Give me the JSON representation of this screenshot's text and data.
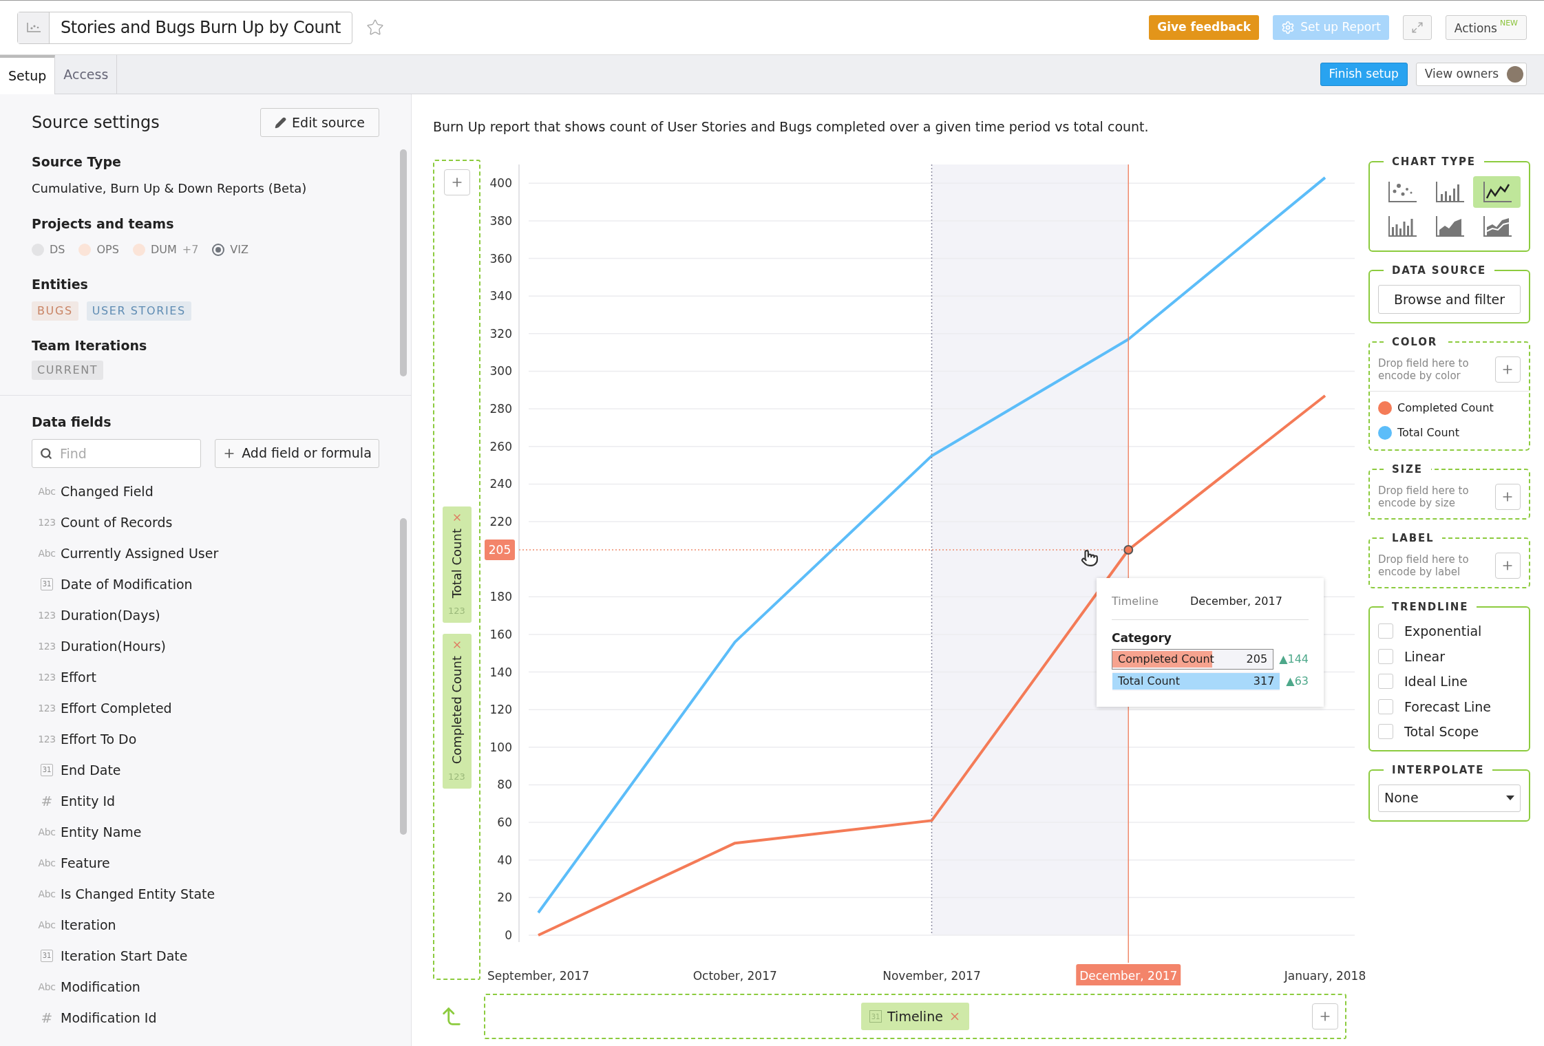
{
  "header": {
    "title": "Stories and Bugs Burn Up by Count",
    "starred": false,
    "feedback_button": "Give feedback",
    "setup_button": "Set up Report",
    "actions_button": "Actions",
    "actions_badge": "NEW"
  },
  "tabs": [
    {
      "label": "Setup",
      "selected": true
    },
    {
      "label": "Access",
      "selected": false
    }
  ],
  "toolbar": {
    "finish_button": "Finish setup",
    "owners_button": "View owners"
  },
  "source_settings": {
    "title": "Source settings",
    "edit_button": "Edit source",
    "source_type_label": "Source Type",
    "source_type": "Cumulative, Burn Up & Down Reports (Beta)",
    "projects_label": "Projects and teams",
    "projects": [
      {
        "kind": "dot",
        "name": "DS",
        "color": "#e3e3e5"
      },
      {
        "kind": "dot",
        "name": "OPS",
        "color": "#fbe4d8"
      },
      {
        "kind": "dot",
        "name": "DUM",
        "color": "#fbe4d8",
        "more": "+7"
      },
      {
        "kind": "emblem",
        "name": "VIZ",
        "color": "#70757d"
      }
    ],
    "entities_label": "Entities",
    "entities": [
      {
        "name": "BUGS",
        "color": "#c98465"
      },
      {
        "name": "USER STORIES",
        "color": "#5f8cb3"
      }
    ],
    "iterations_label": "Team Iterations",
    "iterations": [
      "CURRENT"
    ]
  },
  "data_fields": {
    "title": "Data fields",
    "search": {
      "placeholder": "Find"
    },
    "add_button": "Add field or formula",
    "items": [
      {
        "kind": "text",
        "type_label": "Abc",
        "name": "Changed Field"
      },
      {
        "kind": "number",
        "type_label": "123",
        "name": "Count of Records"
      },
      {
        "kind": "text",
        "type_label": "Abc",
        "name": "Currently Assigned User"
      },
      {
        "kind": "date",
        "type_label": "31",
        "name": "Date of Modification"
      },
      {
        "kind": "number",
        "type_label": "123",
        "name": "Duration(Days)"
      },
      {
        "kind": "number",
        "type_label": "123",
        "name": "Duration(Hours)"
      },
      {
        "kind": "number",
        "type_label": "123",
        "name": "Effort"
      },
      {
        "kind": "number",
        "type_label": "123",
        "name": "Effort Completed"
      },
      {
        "kind": "number",
        "type_label": "123",
        "name": "Effort To Do"
      },
      {
        "kind": "date",
        "type_label": "31",
        "name": "End Date"
      },
      {
        "kind": "id",
        "type_label": "#",
        "name": "Entity Id"
      },
      {
        "kind": "text",
        "type_label": "Abc",
        "name": "Entity Name"
      },
      {
        "kind": "text",
        "type_label": "Abc",
        "name": "Feature"
      },
      {
        "kind": "text",
        "type_label": "Abc",
        "name": "Is Changed Entity State"
      },
      {
        "kind": "text",
        "type_label": "Abc",
        "name": "Iteration"
      },
      {
        "kind": "date",
        "type_label": "31",
        "name": "Iteration Start Date"
      },
      {
        "kind": "text",
        "type_label": "Abc",
        "name": "Modification"
      },
      {
        "kind": "id",
        "type_label": "#",
        "name": "Modification Id"
      }
    ]
  },
  "description": "Burn Up report that shows count of User Stories and Bugs completed over a given time period vs total count.",
  "y_fields": [
    {
      "name": "Total Count",
      "type_label": "123"
    },
    {
      "name": "Completed Count",
      "type_label": "123"
    }
  ],
  "x_field": {
    "name": "Timeline",
    "type_label": "31"
  },
  "chart": {
    "chart_data": {
      "type": "line",
      "categories": [
        "September, 2017",
        "October, 2017",
        "November, 2017",
        "December, 2017",
        "January, 2018"
      ],
      "series": [
        {
          "name": "Completed Count",
          "color": "#f47b57",
          "values": [
            0,
            49,
            61,
            205,
            287
          ]
        },
        {
          "name": "Total Count",
          "color": "#5cbdf9",
          "values": [
            12,
            156,
            255,
            317,
            403
          ]
        }
      ],
      "ylim": [
        0,
        410
      ],
      "yticks": [
        0,
        20,
        40,
        60,
        80,
        100,
        120,
        140,
        160,
        180,
        220,
        240,
        260,
        280,
        300,
        320,
        340,
        360,
        380,
        400
      ],
      "grid": true,
      "bands": [
        {
          "axis": "x",
          "from": "November, 2017",
          "to": "December, 2017"
        }
      ],
      "ref_lines": [
        {
          "axis": "x",
          "value": "November, 2017"
        },
        {
          "axis": "x",
          "value": "December, 2017"
        },
        {
          "axis": "y",
          "value": 205,
          "label": "205"
        }
      ]
    },
    "tooltip": {
      "timeline_label": "Timeline",
      "timeline_value": "December, 2017",
      "category_label": "Category",
      "rows": [
        {
          "name": "Completed Count",
          "value": "205",
          "delta": "▲144",
          "color": "#f6a38f",
          "level": 0.62,
          "selected": true
        },
        {
          "name": "Total Count",
          "value": "317",
          "delta": "▲63",
          "color": "#a8d9fb",
          "level": 1,
          "selected": false
        }
      ]
    }
  },
  "panel": {
    "chart_type_title": "CHART TYPE",
    "chart_types": [
      {
        "kind": "scatter",
        "selected": false
      },
      {
        "kind": "bar",
        "selected": false
      },
      {
        "kind": "line",
        "selected": true
      },
      {
        "kind": "stacked-bar",
        "selected": false
      },
      {
        "kind": "area",
        "selected": false
      },
      {
        "kind": "stacked-area",
        "selected": false
      }
    ],
    "data_source_title": "DATA SOURCE",
    "data_source_button": "Browse and filter",
    "color_title": "COLOR",
    "color_hint": "Drop field here to encode by color",
    "size_title": "SIZE",
    "size_hint": "Drop field here to encode by size",
    "label_title": "LABEL",
    "label_hint": "Drop field here to encode by label",
    "trendline_title": "TRENDLINE",
    "trendlines": [
      {
        "label": "Exponential",
        "checked": false
      },
      {
        "label": "Linear",
        "checked": false
      },
      {
        "label": "Ideal Line",
        "checked": false
      },
      {
        "label": "Forecast Line",
        "checked": false
      },
      {
        "label": "Total Scope",
        "checked": false
      }
    ],
    "interpolate_title": "INTERPOLATE",
    "interpolate_value": "None"
  }
}
